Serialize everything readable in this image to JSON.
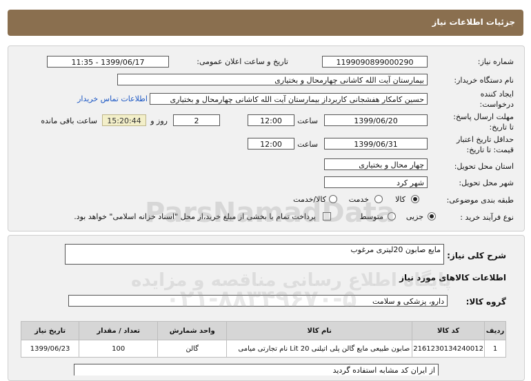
{
  "header": {
    "title": "جزئیات اطلاعات نیاز"
  },
  "form": {
    "need_number": {
      "label": "شماره نیاز:",
      "value": "1199090899000290"
    },
    "announce_datetime": {
      "label": "تاریخ و ساعت اعلان عمومی:",
      "value": "1399/06/17 - 11:35"
    },
    "buyer_org": {
      "label": "نام دستگاه خریدار:",
      "value": "بیمارستان آیت الله کاشانی چهارمحال و بختیاری"
    },
    "creator": {
      "label_line1": "ایجاد کننده",
      "label_line2": "درخواست:",
      "value": "حسین کامکار هفشجانی کاربرداز بیمارستان آیت الله کاشانی چهارمحال و بختیاری",
      "contact_link": "اطلاعات تماس خریدار"
    },
    "reply_deadline": {
      "label_line1": "مهلت ارسال پاسخ:",
      "label_line2": "تا تاریخ:",
      "date": "1399/06/20",
      "time_label": "ساعت",
      "time": "12:00",
      "days": "2",
      "days_label": "روز و",
      "countdown": "15:20:44",
      "remaining_label": "ساعت باقی مانده"
    },
    "price_validity": {
      "label_line1": "حداقل تاریخ اعتبار",
      "label_line2": "قیمت: تا تاریخ:",
      "date": "1399/06/31",
      "time_label": "ساعت",
      "time": "12:00"
    },
    "province": {
      "label": "استان محل تحویل:",
      "value": "چهار محال و بختیاری"
    },
    "city": {
      "label": "شهر محل تحویل:",
      "value": "شهر کرد"
    },
    "category": {
      "label": "طبقه بندی موضوعی:",
      "options": [
        "کالا",
        "خدمت",
        "کالا/خدمت"
      ],
      "selected": "کالا"
    },
    "purchase_type": {
      "label": "نوع فرآیند خرید :",
      "options": [
        "جزیی",
        "متوسط"
      ],
      "selected": "جزیی",
      "payment_note": "پرداخت تمام یا بخشی از مبلغ خرید،از محل \"اسناد خزانه اسلامی\" خواهد بود."
    }
  },
  "summary": {
    "label": "شرح کلی نیاز:",
    "value": "مایع صابون 20لیتری مرغوب"
  },
  "goods": {
    "section_title": "اطلاعات کالاهای مورد نیاز",
    "group_label": "گروه کالا:",
    "group_value": "دارو، پزشکی و سلامت",
    "columns": [
      "ردیف",
      "کد کالا",
      "نام کالا",
      "واحد شمارش",
      "تعداد / مقدار",
      "تاریخ نیاز"
    ],
    "rows": [
      [
        "1",
        "2161230134240012",
        "صابون طبیعی مایع گالن پلی اتیلنی 20 Lit نام تجارتی میامی",
        "گالن",
        "100",
        "1399/06/23"
      ]
    ]
  },
  "buyer_notes": {
    "value": "از ایران کد مشابه استفاده گردید"
  },
  "watermark": {
    "brand": "ParsNamadData",
    "line1": "پایگاه اطلاع رسانی مناقصه و مزایده",
    "line2": "۰۲۱-۸۸۳۴۹۶۷۰-۵"
  },
  "colors": {
    "header_bg": "#8a6f4f",
    "link": "#1a56c4",
    "timer_bg": "#f3efc9"
  }
}
